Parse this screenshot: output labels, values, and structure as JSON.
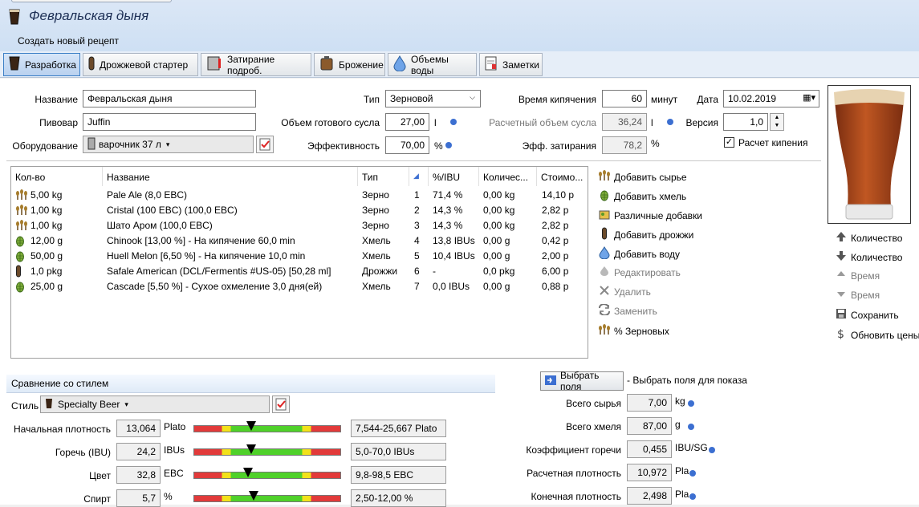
{
  "header": {
    "recipe_title": "Февральская дыня",
    "new_recipe": "Создать новый рецепт"
  },
  "tabs": [
    {
      "label": "Разработка",
      "icon": "beer-glass-icon",
      "active": true
    },
    {
      "label": "Дрожжевой стартер",
      "icon": "yeast-tube-icon"
    },
    {
      "label": "Затирание подроб.",
      "icon": "mash-tun-icon"
    },
    {
      "label": "Брожение",
      "icon": "fermenter-icon"
    },
    {
      "label": "Объемы воды",
      "icon": "water-drop-icon"
    },
    {
      "label": "Заметки",
      "icon": "notes-icon"
    }
  ],
  "form": {
    "name_label": "Название",
    "name_value": "Февральская дыня",
    "brewer_label": "Пивовар",
    "brewer_value": "Juffin",
    "equipment_label": "Оборудование",
    "equipment_value": "варочник 37 л",
    "type_label": "Тип",
    "type_value": "Зерновой",
    "batch_label": "Объем готового сусла",
    "batch_value": "27,00",
    "batch_unit": "l",
    "eff_label": "Эффективность",
    "eff_value": "70,00",
    "eff_unit": "%",
    "boil_label": "Время кипячения",
    "boil_value": "60",
    "boil_unit": "минут",
    "calc_vol_label": "Расчетный объем сусла",
    "calc_vol_value": "36,24",
    "calc_vol_unit": "l",
    "mash_eff_label": "Эфф. затирания",
    "mash_eff_value": "78,2",
    "mash_eff_unit": "%",
    "date_label": "Дата",
    "date_value": "10.02.2019",
    "version_label": "Версия",
    "version_value": "1,0",
    "calc_boil_label": "Расчет кипения",
    "calc_boil_checked": true
  },
  "ingredients": {
    "columns": [
      "Кол-во",
      "Название",
      "Тип",
      "",
      "%/IBU",
      "Количес...",
      "Стоимо..."
    ],
    "rows": [
      {
        "amount": "5,00 kg",
        "name": "Pale Ale (8,0 EBC)",
        "type": "Зерно",
        "n": "1",
        "pct": "71,4 %",
        "inv": "0,00 kg",
        "cost": "14,10 р",
        "icon": "grain-icon"
      },
      {
        "amount": "1,00 kg",
        "name": "Cristal (100 EBC) (100,0 EBC)",
        "type": "Зерно",
        "n": "2",
        "pct": "14,3 %",
        "inv": "0,00 kg",
        "cost": "2,82 р",
        "icon": "grain-icon"
      },
      {
        "amount": "1,00 kg",
        "name": "Шато Аром (100,0 EBC)",
        "type": "Зерно",
        "n": "3",
        "pct": "14,3 %",
        "inv": "0,00 kg",
        "cost": "2,82 р",
        "icon": "grain-icon"
      },
      {
        "amount": "12,00 g",
        "name": "Chinook [13,00 %] - На кипячение 60,0 min",
        "type": "Хмель",
        "n": "4",
        "pct": "13,8 IBUs",
        "inv": "0,00 g",
        "cost": "0,42 р",
        "icon": "hop-icon"
      },
      {
        "amount": "50,00 g",
        "name": "Huell Melon [6,50 %] - На кипячение 10,0 min",
        "type": "Хмель",
        "n": "5",
        "pct": "10,4 IBUs",
        "inv": "0,00 g",
        "cost": "2,00 р",
        "icon": "hop-icon"
      },
      {
        "amount": "1,0 pkg",
        "name": "Safale American  (DCL/Fermentis #US-05) [50,28 ml]",
        "type": "Дрожжи",
        "n": "6",
        "pct": "-",
        "inv": "0,0 pkg",
        "cost": "6,00 р",
        "icon": "yeast-icon"
      },
      {
        "amount": "25,00 g",
        "name": "Cascade [5,50 %] - Сухое охмеление 3,0 дня(ей)",
        "type": "Хмель",
        "n": "7",
        "pct": "0,0 IBUs",
        "inv": "0,00 g",
        "cost": "0,88 р",
        "icon": "hop-icon"
      }
    ]
  },
  "actions": [
    {
      "label": "Добавить сырье",
      "icon": "grain-icon"
    },
    {
      "label": "Добавить хмель",
      "icon": "hop-icon"
    },
    {
      "label": "Различные добавки",
      "icon": "misc-icon"
    },
    {
      "label": "Добавить дрожжи",
      "icon": "yeast-icon"
    },
    {
      "label": "Добавить воду",
      "icon": "water-drop-icon"
    },
    {
      "label": "Редактировать",
      "icon": "edit-icon",
      "disabled": true
    },
    {
      "label": "Удалить",
      "icon": "delete-icon",
      "disabled": true
    },
    {
      "label": "Заменить",
      "icon": "replace-icon",
      "disabled": true
    },
    {
      "label": "% Зерновых",
      "icon": "grain-icon"
    }
  ],
  "side_actions": [
    {
      "label": "Количество",
      "icon": "arrow-up-icon"
    },
    {
      "label": "Количество",
      "icon": "arrow-down-icon"
    },
    {
      "label": "Время",
      "icon": "arrow-up-small-icon",
      "disabled": true
    },
    {
      "label": "Время",
      "icon": "arrow-down-small-icon",
      "disabled": true
    },
    {
      "label": "Сохранить",
      "icon": "save-icon"
    },
    {
      "label": "Обновить цены",
      "icon": "dollar-icon"
    }
  ],
  "style": {
    "section_title": "Сравнение со стилем",
    "style_label": "Стиль",
    "style_value": "Specialty Beer",
    "rows": [
      {
        "label": "Начальная плотность",
        "value": "13,064",
        "unit": "Plato",
        "range": "7,544-25,667 Plato",
        "pos": 0.39
      },
      {
        "label": "Горечь (IBU)",
        "value": "24,2",
        "unit": "IBUs",
        "range": "5,0-70,0 IBUs",
        "pos": 0.39
      },
      {
        "label": "Цвет",
        "value": "32,8",
        "unit": "EBC",
        "range": "9,8-98,5 EBC",
        "pos": 0.37
      },
      {
        "label": "Спирт",
        "value": "5,7",
        "unit": "%",
        "range": "2,50-12,00 %",
        "pos": 0.41
      }
    ]
  },
  "fields_panel": {
    "button_label": "Выбрать поля",
    "hint": "- Выбрать поля для показа",
    "rows": [
      {
        "label": "Всего сырья",
        "value": "7,00",
        "unit": "kg"
      },
      {
        "label": "Всего хмеля",
        "value": "87,00",
        "unit": "g"
      },
      {
        "label": "Коэффициент горечи",
        "value": "0,455",
        "unit": "IBU/SG"
      },
      {
        "label": "Расчетная плотность",
        "value": "10,972",
        "unit": "Pla"
      },
      {
        "label": "Конечная плотность",
        "value": "2,498",
        "unit": "Pla"
      }
    ]
  },
  "colors": {
    "accent": "#3c6fd1",
    "beer": "#a9461c",
    "bar_red": "#e23a3a",
    "bar_yellow": "#f2e21a",
    "bar_green": "#4fd12a"
  }
}
